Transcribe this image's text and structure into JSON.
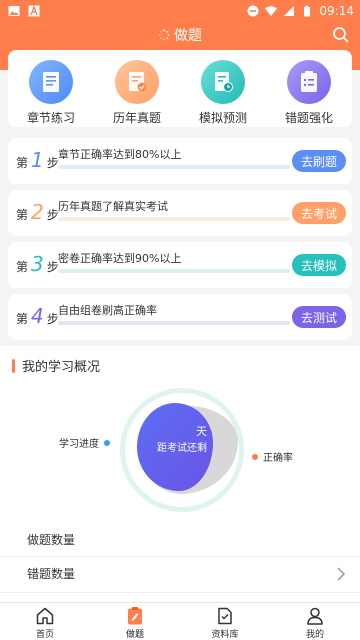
{
  "status": {
    "time": "09:14"
  },
  "header": {
    "title": "做题"
  },
  "categories": [
    {
      "label": "章节练习",
      "icon": "book-icon",
      "color": "#5b95f7"
    },
    {
      "label": "历年真题",
      "icon": "paper-check-icon",
      "color": "#ffa56d"
    },
    {
      "label": "模拟预测",
      "icon": "clock-document-icon",
      "color": "#2cc0bb"
    },
    {
      "label": "错题强化",
      "icon": "clipboard-list-icon",
      "color": "#7e68e9"
    }
  ],
  "steps": [
    {
      "prefix": "第",
      "num": "1",
      "suffix": "步",
      "text": "章节正确率达到80%以上",
      "button": "去刷题",
      "color": "#5b8ff5",
      "bar_color": "#e3ecfd"
    },
    {
      "prefix": "第",
      "num": "2",
      "suffix": "步",
      "text": "历年真题了解真实考试",
      "button": "去考试",
      "color": "#ffa06b",
      "bar_color": "#fde9dd"
    },
    {
      "prefix": "第",
      "num": "3",
      "suffix": "步",
      "text": "密卷正确率达到90%以上",
      "button": "去模拟",
      "color": "#27c1bd",
      "bar_color": "#daf3f2"
    },
    {
      "prefix": "第",
      "num": "4",
      "suffix": "步",
      "text": "自由组卷刷高正确率",
      "button": "去测试",
      "color": "#7d63e6",
      "bar_color": "#e7e2fb"
    }
  ],
  "overview": {
    "title": "我的学习概况",
    "days_unit": "天",
    "days_label": "距考试还剩",
    "legend_progress": "学习进度",
    "legend_accuracy": "正确率",
    "progress_color": "#3a9bf0",
    "accuracy_color": "#ff7e4b",
    "rows": [
      "做题数量",
      "错题数量"
    ]
  },
  "tabs": [
    {
      "label": "首页",
      "icon": "home-icon"
    },
    {
      "label": "做题",
      "icon": "exam-icon",
      "active": true
    },
    {
      "label": "资料库",
      "icon": "document-icon"
    },
    {
      "label": "我的",
      "icon": "user-icon"
    }
  ]
}
